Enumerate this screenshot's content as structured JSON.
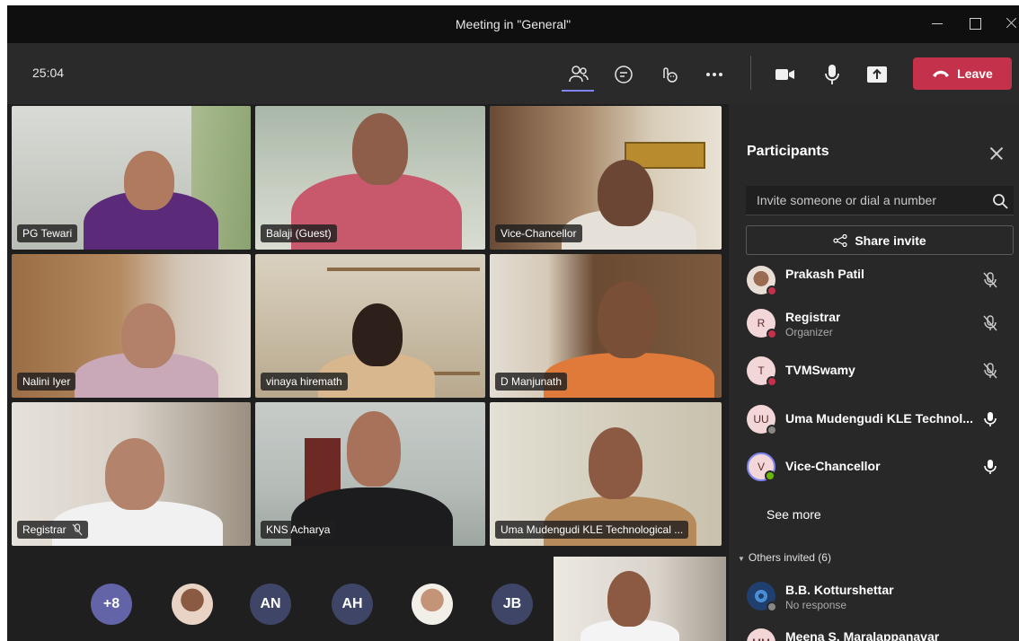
{
  "window": {
    "title": "Meeting in \"General\""
  },
  "toolbar": {
    "timer": "25:04",
    "icons": [
      "people-icon",
      "chat-icon",
      "reactions-icon",
      "more-icon",
      "camera-icon",
      "mic-icon",
      "share-icon"
    ],
    "leave_label": "Leave"
  },
  "tiles": [
    {
      "name": "PG Tewari",
      "muted": false
    },
    {
      "name": "Balaji (Guest)",
      "muted": false
    },
    {
      "name": "Vice-Chancellor",
      "muted": false
    },
    {
      "name": "Nalini Iyer",
      "muted": false
    },
    {
      "name": "vinaya hiremath",
      "muted": false
    },
    {
      "name": "D Manjunath",
      "muted": false
    },
    {
      "name": "Registrar",
      "muted": true
    },
    {
      "name": "KNS Acharya",
      "muted": false
    },
    {
      "name": "Uma Mudengudi KLE Technological ...",
      "muted": false
    }
  ],
  "bottom_row": {
    "overflow_count": "+8",
    "initials": [
      "AN",
      "AH",
      "JB"
    ]
  },
  "panel": {
    "title": "Participants",
    "invite_placeholder": "Invite someone or dial a number",
    "share_invite": "Share invite",
    "participants": [
      {
        "name": "Prakash Patil",
        "role": "",
        "initials": "",
        "mic": "muted"
      },
      {
        "name": "Registrar",
        "role": "Organizer",
        "initials": "R",
        "mic": "muted"
      },
      {
        "name": "TVMSwamy",
        "role": "",
        "initials": "T",
        "mic": "muted"
      },
      {
        "name": "Uma Mudengudi KLE Technol...",
        "role": "",
        "initials": "UU",
        "mic": "on"
      },
      {
        "name": "Vice-Chancellor",
        "role": "",
        "initials": "V",
        "mic": "on"
      }
    ],
    "see_more": "See more",
    "others_invited": "Others invited (6)",
    "invited": [
      {
        "name": "B.B. Kotturshettar",
        "status": "No response",
        "initials": ""
      },
      {
        "name": "Meena S. Maralappanavar",
        "status": "",
        "initials": "MM"
      }
    ]
  },
  "colors": {
    "leave": "#c4314b",
    "accent": "#7f85f5",
    "panel_bg": "#292828",
    "status_red": "#c4314b",
    "status_green": "#6bb700"
  }
}
